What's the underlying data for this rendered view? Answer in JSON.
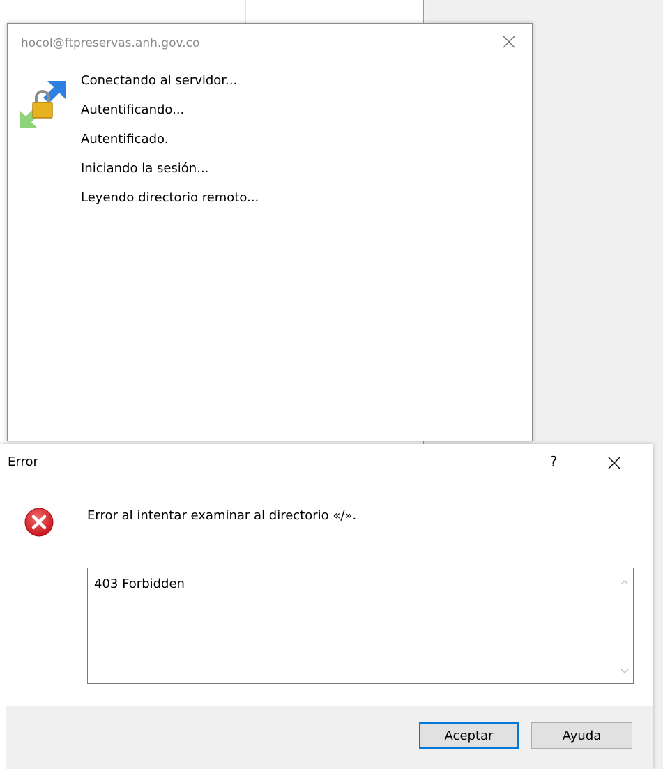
{
  "connection_dialog": {
    "title": "hocol@ftpreservas.anh.gov.co",
    "icon": "connect-lock-icon",
    "log": [
      "Conectando al servidor...",
      "Autentificando...",
      "Autentificado.",
      "Iniciando la sesión...",
      "Leyendo directorio remoto..."
    ]
  },
  "error_dialog": {
    "title": "Error",
    "help_glyph": "?",
    "icon": "error-icon",
    "message": "Error al intentar examinar al directorio «/».",
    "detail": "403 Forbidden",
    "buttons": {
      "ok_label": "Aceptar",
      "help_label": "Ayuda"
    }
  },
  "colors": {
    "accent": "#0078d7",
    "error_red": "#e81123",
    "title_gray": "#8a8a8a",
    "footer_bg": "#f0f0f0"
  }
}
